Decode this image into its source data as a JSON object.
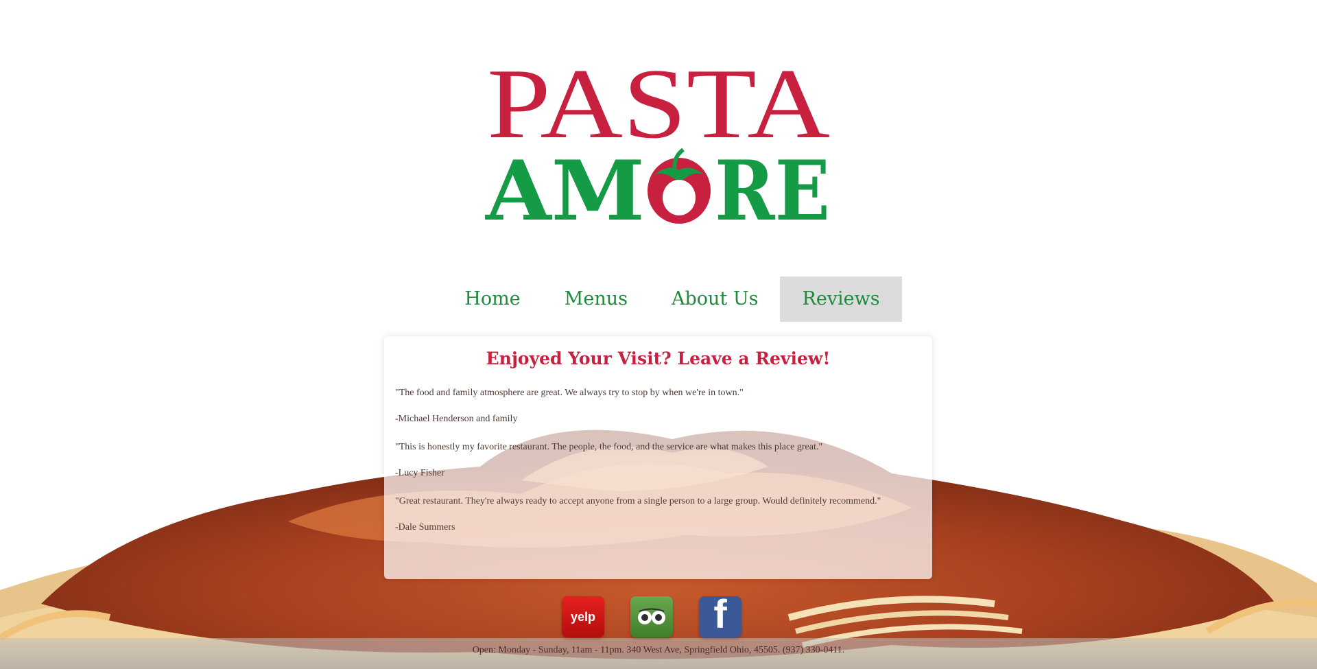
{
  "brand": {
    "line1": "PASTA",
    "line2_left": "AM",
    "line2_right": "RE",
    "colors": {
      "red": "#c8203f",
      "green": "#159a46"
    }
  },
  "nav": {
    "items": [
      {
        "label": "Home"
      },
      {
        "label": "Menus"
      },
      {
        "label": "About Us"
      },
      {
        "label": "Reviews",
        "active": true
      }
    ]
  },
  "reviews": {
    "title": "Enjoyed Your Visit? Leave a Review!",
    "items": [
      {
        "quote": "\"The food and family atmosphere are great. We always try to stop by when we're in town.\"",
        "author": "-Michael Henderson and family"
      },
      {
        "quote": "\"This is honestly my favorite restaurant. The people, the food, and the service are what makes this place great.\"",
        "author": "-Lucy Fisher"
      },
      {
        "quote": "\"Great restaurant. They're always ready to accept anyone from a single person to a large group. Would definitely recommend.\"",
        "author": "-Dale Summers"
      }
    ]
  },
  "social": {
    "yelp_text": "yelp",
    "facebook_text": "f",
    "icons": [
      "yelp-icon",
      "tripadvisor-icon",
      "facebook-icon"
    ]
  },
  "footer": {
    "text": "Open: Monday - Sunday, 11am - 11pm. 340 West Ave, Springfield Ohio, 45505. (937) 330-0411."
  }
}
